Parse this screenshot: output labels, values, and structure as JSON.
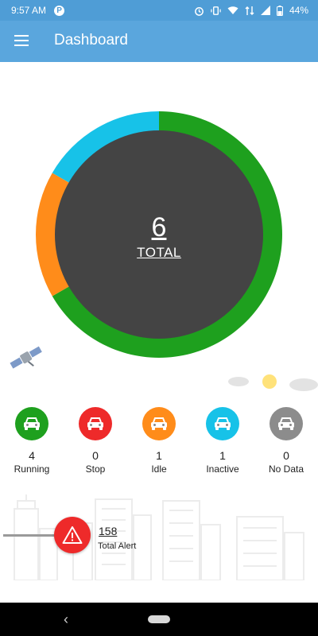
{
  "status_bar": {
    "time": "9:57 AM",
    "app_badge": "P",
    "battery": "44%"
  },
  "header": {
    "title": "Dashboard",
    "menu_icon": "menu-icon"
  },
  "summary": {
    "total_value": "6",
    "total_label": "TOTAL"
  },
  "chart_data": {
    "type": "pie",
    "style": "donut",
    "categories": [
      "Running",
      "Stop",
      "Idle",
      "Inactive",
      "No Data"
    ],
    "values": [
      4,
      0,
      1,
      1,
      0
    ],
    "colors": [
      "#1ea01e",
      "#ee2a2a",
      "#ff8c1a",
      "#17c2e8",
      "#8c8c8c"
    ],
    "start_angle_deg": 0,
    "center_color": "#444444"
  },
  "statuses": [
    {
      "count": "4",
      "label": "Running",
      "color": "#1ea01e",
      "icon": "car-icon"
    },
    {
      "count": "0",
      "label": "Stop",
      "color": "#ee2a2a",
      "icon": "car-icon"
    },
    {
      "count": "1",
      "label": "Idle",
      "color": "#ff8c1a",
      "icon": "car-icon"
    },
    {
      "count": "1",
      "label": "Inactive",
      "color": "#17c2e8",
      "icon": "car-icon"
    },
    {
      "count": "0",
      "label": "No Data",
      "color": "#8c8c8c",
      "icon": "car-icon"
    }
  ],
  "alert": {
    "count": "158",
    "label": "Total Alert",
    "color": "#ee2a2a",
    "icon": "warning-icon"
  }
}
